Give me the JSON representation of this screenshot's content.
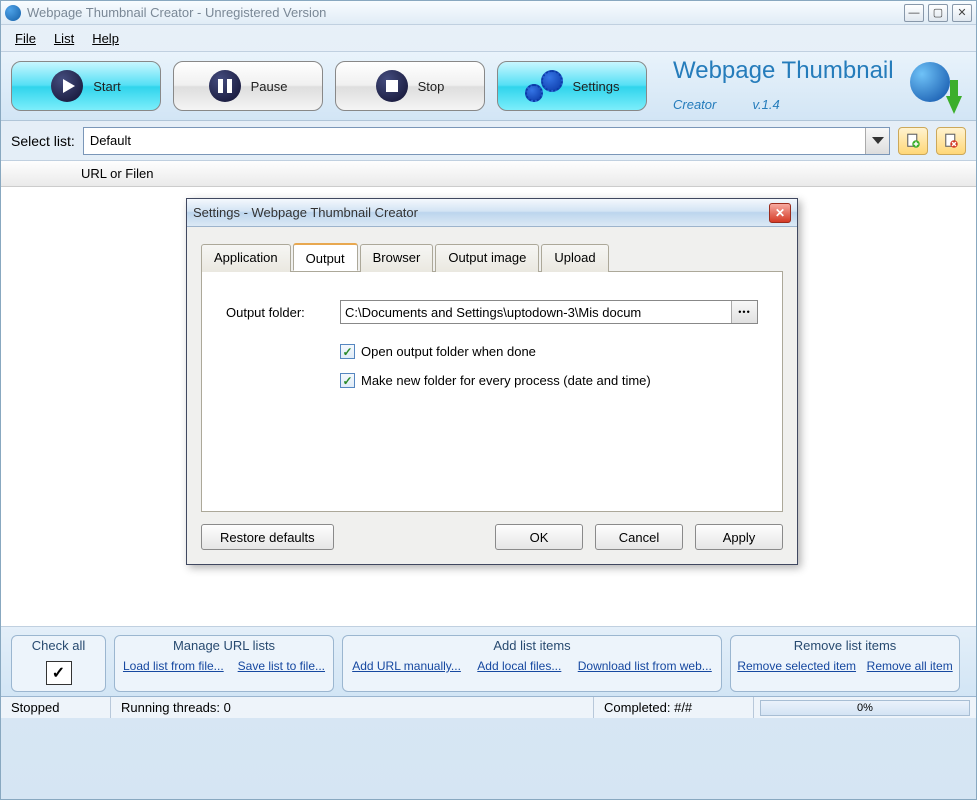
{
  "main_window": {
    "title": "Webpage Thumbnail Creator - Unregistered Version",
    "menus": {
      "file": "File",
      "list": "List",
      "help": "Help"
    },
    "toolbar": {
      "start": "Start",
      "pause": "Pause",
      "stop": "Stop",
      "settings": "Settings"
    },
    "app_brand": {
      "name": "Webpage Thumbnail",
      "sub": "Creator",
      "version": "v.1.4"
    },
    "select_list_label": "Select list:",
    "select_list_value": "Default",
    "list_header": "URL or Filen",
    "bottom": {
      "check_all": "Check all",
      "manage_title": "Manage URL lists",
      "load_list": "Load list from file...",
      "save_list": "Save list to file...",
      "add_title": "Add list items",
      "add_url": "Add URL manually...",
      "add_local": "Add local files...",
      "download_list": "Download list from web...",
      "remove_title": "Remove list items",
      "remove_selected": "Remove selected item",
      "remove_all": "Remove all item"
    },
    "status": {
      "stopped": "Stopped",
      "threads": "Running threads: 0",
      "completed": "Completed: #/#",
      "progress": "0%"
    }
  },
  "dialog": {
    "title": "Settings - Webpage Thumbnail Creator",
    "tabs": {
      "application": "Application",
      "output": "Output",
      "browser": "Browser",
      "output_image": "Output image",
      "upload": "Upload"
    },
    "output_folder_label": "Output folder:",
    "output_folder_value": "C:\\Documents and Settings\\uptodown-3\\Mis docum",
    "browse_label": "•••",
    "cb_open": "Open output folder when done",
    "cb_newfolder": "Make new folder for every process (date and time)",
    "cb_open_checked": true,
    "cb_newfolder_checked": true,
    "buttons": {
      "restore": "Restore defaults",
      "ok": "OK",
      "cancel": "Cancel",
      "apply": "Apply"
    }
  }
}
